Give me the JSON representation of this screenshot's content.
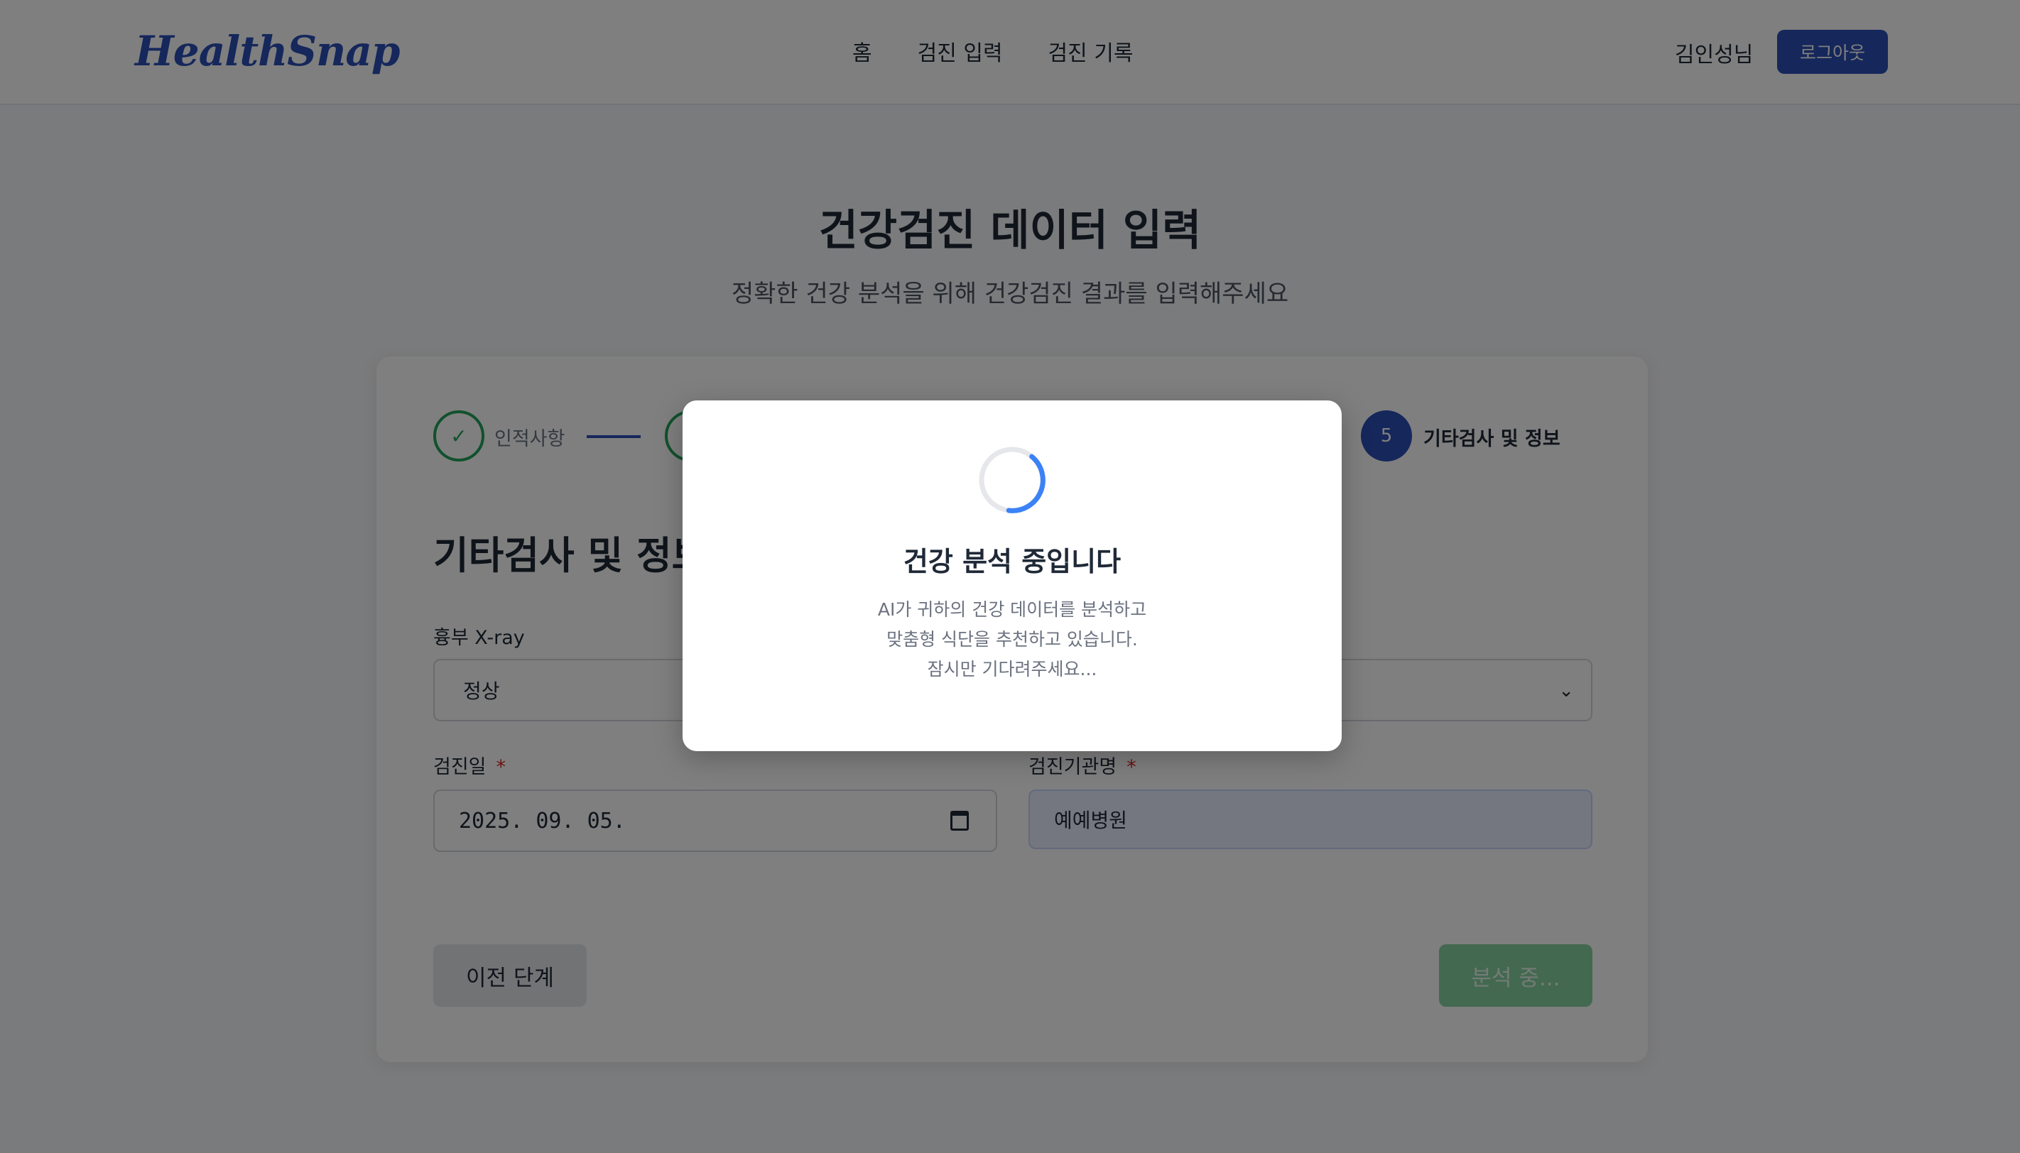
{
  "header": {
    "logo": "HealthSnap",
    "nav": [
      "홈",
      "검진 입력",
      "검진 기록"
    ],
    "user_name": "김인성님",
    "logout_label": "로그아웃"
  },
  "page": {
    "title": "건강검진 데이터 입력",
    "subtitle": "정확한 건강 분석을 위해 건강검진 결과를 입력해주세요"
  },
  "stepper": {
    "step1_label": "인적사항",
    "step1_icon": "✓",
    "step2_icon": "✓",
    "active_number": "5",
    "active_label": "기타검사 및 정보"
  },
  "form": {
    "section_title": "기타검사 및 정보",
    "xray_label": "흉부 X-ray",
    "xray_value": "정상",
    "date_label": "검진일",
    "date_value": "2025. 09. 05.",
    "hospital_label": "검진기관명",
    "hospital_value": "예예병원",
    "required_mark": "*",
    "prev_label": "이전 단계",
    "submit_label": "분석 중..."
  },
  "modal": {
    "title": "건강 분석 중입니다",
    "line1": "AI가 귀하의 건강 데이터를 분석하고",
    "line2": "맞춤형 식단을 추천하고 있습니다.",
    "line3": "잠시만 기다려주세요..."
  },
  "colors": {
    "brand": "#2a4fb7",
    "success": "#22a35a",
    "submit_disabled": "#86d3a0",
    "spinner": "#3b82f6"
  }
}
